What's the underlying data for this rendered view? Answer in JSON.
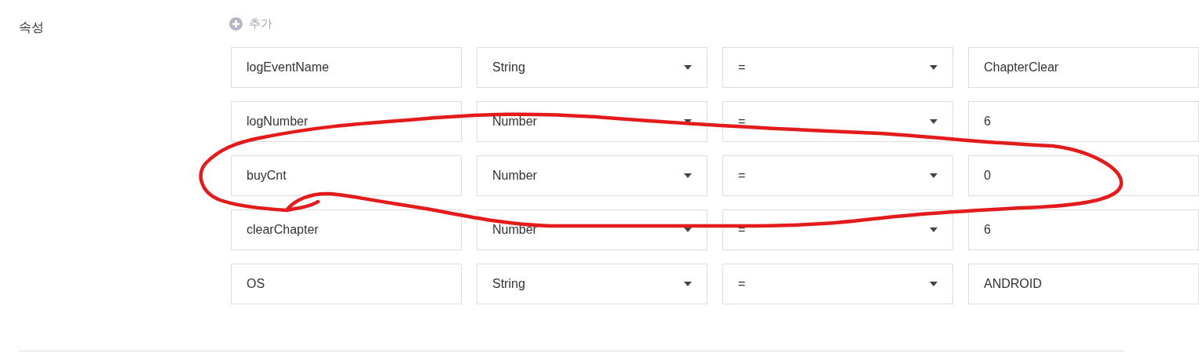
{
  "section_label": "속성",
  "add_button": {
    "label": "추가"
  },
  "rows": [
    {
      "name": "logEventName",
      "type": "String",
      "operator": "=",
      "value": "ChapterClear"
    },
    {
      "name": "logNumber",
      "type": "Number",
      "operator": "=",
      "value": "6"
    },
    {
      "name": "buyCnt",
      "type": "Number",
      "operator": "=",
      "value": "0"
    },
    {
      "name": "clearChapter",
      "type": "Number",
      "operator": "=",
      "value": "6"
    },
    {
      "name": "OS",
      "type": "String",
      "operator": "=",
      "value": "ANDROID"
    }
  ],
  "annotation": {
    "kind": "freehand-loop"
  }
}
